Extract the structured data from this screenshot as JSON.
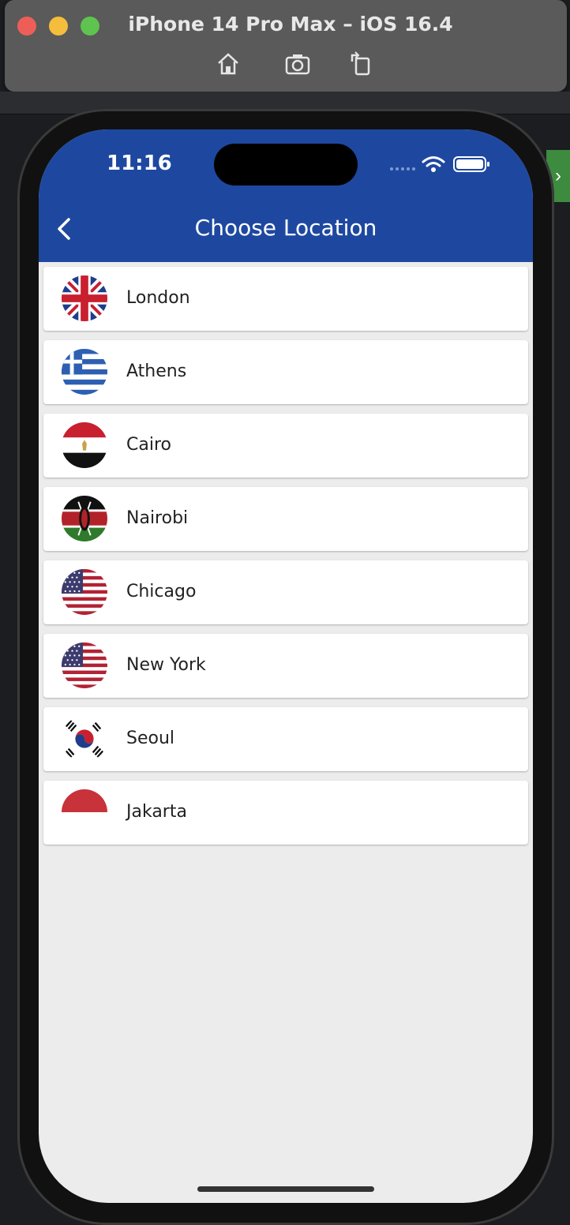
{
  "simulator": {
    "title": "iPhone 14 Pro Max – iOS 16.4",
    "toolbar_icons": [
      "home-icon",
      "screenshot-icon",
      "rotate-icon"
    ]
  },
  "status_bar": {
    "time": "11:16"
  },
  "nav": {
    "title": "Choose Location",
    "back_icon": "chevron-left-icon"
  },
  "locations": [
    {
      "label": "London",
      "flag": "united-kingdom-flag-icon"
    },
    {
      "label": "Athens",
      "flag": "greece-flag-icon"
    },
    {
      "label": "Cairo",
      "flag": "egypt-flag-icon"
    },
    {
      "label": "Nairobi",
      "flag": "kenya-flag-icon"
    },
    {
      "label": "Chicago",
      "flag": "usa-flag-icon"
    },
    {
      "label": "New York",
      "flag": "usa-flag-icon"
    },
    {
      "label": "Seoul",
      "flag": "south-korea-flag-icon"
    },
    {
      "label": "Jakarta",
      "flag": "indonesia-flag-icon"
    }
  ],
  "colors": {
    "header": "#1e48a0",
    "background": "#ececec",
    "item": "#ffffff"
  }
}
